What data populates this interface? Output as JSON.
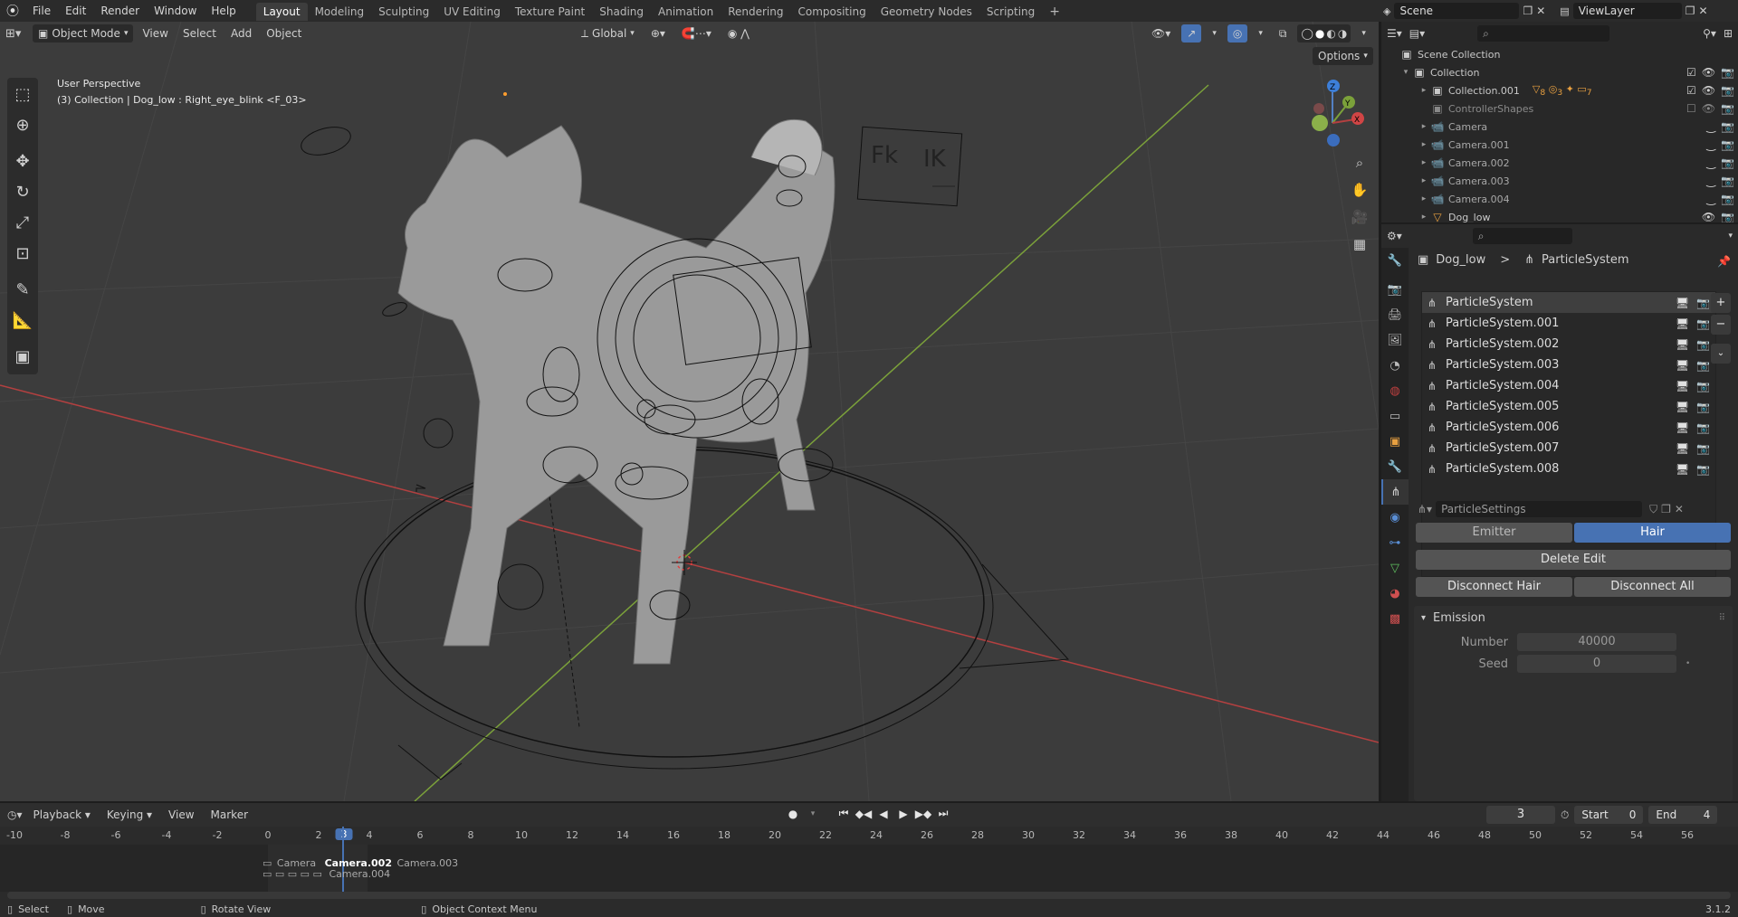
{
  "menu": {
    "items": [
      "File",
      "Edit",
      "Render",
      "Window",
      "Help"
    ]
  },
  "workspaces": [
    "Layout",
    "Modeling",
    "Sculpting",
    "UV Editing",
    "Texture Paint",
    "Shading",
    "Animation",
    "Rendering",
    "Compositing",
    "Geometry Nodes",
    "Scripting"
  ],
  "workspace_add": "+",
  "scene_field": "Scene",
  "viewlayer_field": "ViewLayer",
  "viewport": {
    "mode": "Object Mode",
    "menus": [
      "View",
      "Select",
      "Add",
      "Object"
    ],
    "orientation": "Global",
    "options_label": "Options",
    "info_line1": "User Perspective",
    "info_line2": "(3) Collection | Dog_low : Right_eye_blink <F_03>",
    "gizmo": {
      "x": "X",
      "y": "Y",
      "z": "Z"
    },
    "board_labels": {
      "fk": "Fk",
      "ik": "IK"
    },
    "colors": {
      "x_axis": "#b34040",
      "y_axis": "#7ba13a",
      "bg": "#3c3c3c"
    }
  },
  "outliner": {
    "root": "Scene Collection",
    "rows": [
      {
        "label": "Collection",
        "indent": 1
      },
      {
        "label": "Collection.001",
        "indent": 2
      },
      {
        "label": "ControllerShapes",
        "indent": 2
      },
      {
        "label": "Camera",
        "indent": 2
      },
      {
        "label": "Camera.001",
        "indent": 2
      },
      {
        "label": "Camera.002",
        "indent": 2
      },
      {
        "label": "Camera.003",
        "indent": 2
      },
      {
        "label": "Camera.004",
        "indent": 2
      },
      {
        "label": "Dog_low",
        "indent": 2
      }
    ],
    "badges": {
      "collection001_a": "8",
      "collection001_b": "3",
      "collection001_c": "7"
    }
  },
  "properties": {
    "breadcrumb_object": "Dog_low",
    "breadcrumb_sep": ">",
    "breadcrumb_data": "ParticleSystem",
    "particle_systems": [
      "ParticleSystem",
      "ParticleSystem.001",
      "ParticleSystem.002",
      "ParticleSystem.003",
      "ParticleSystem.004",
      "ParticleSystem.005",
      "ParticleSystem.006",
      "ParticleSystem.007",
      "ParticleSystem.008"
    ],
    "settings_name": "ParticleSettings",
    "type_emitter": "Emitter",
    "type_hair": "Hair",
    "delete_edit": "Delete Edit",
    "disconnect_hair": "Disconnect Hair",
    "disconnect_all": "Disconnect All",
    "emission_title": "Emission",
    "number_label": "Number",
    "number_value": "40000",
    "seed_label": "Seed",
    "seed_value": "0"
  },
  "timeline": {
    "menus": [
      "Playback",
      "Keying",
      "View",
      "Marker"
    ],
    "current_frame": "3",
    "start_label": "Start",
    "start_value": "0",
    "end_label": "End",
    "end_value": "4",
    "ticks": [
      "-10",
      "-8",
      "-6",
      "-4",
      "-2",
      "0",
      "2",
      "3",
      "4",
      "6",
      "8",
      "10",
      "12",
      "14",
      "16",
      "18",
      "20",
      "22",
      "24",
      "26",
      "28",
      "30",
      "32",
      "34",
      "36",
      "38",
      "40",
      "42",
      "44",
      "46",
      "48",
      "50",
      "52",
      "54",
      "56"
    ],
    "markers": {
      "cam_a": "Camera",
      "cam_b": "Camera.002",
      "cam_c": "Camera.003",
      "cam_d": "Camera.004"
    }
  },
  "statusbar": {
    "select": "Select",
    "move": "Move",
    "rotate": "Rotate View",
    "context": "Object Context Menu",
    "version": "3.1.2"
  }
}
